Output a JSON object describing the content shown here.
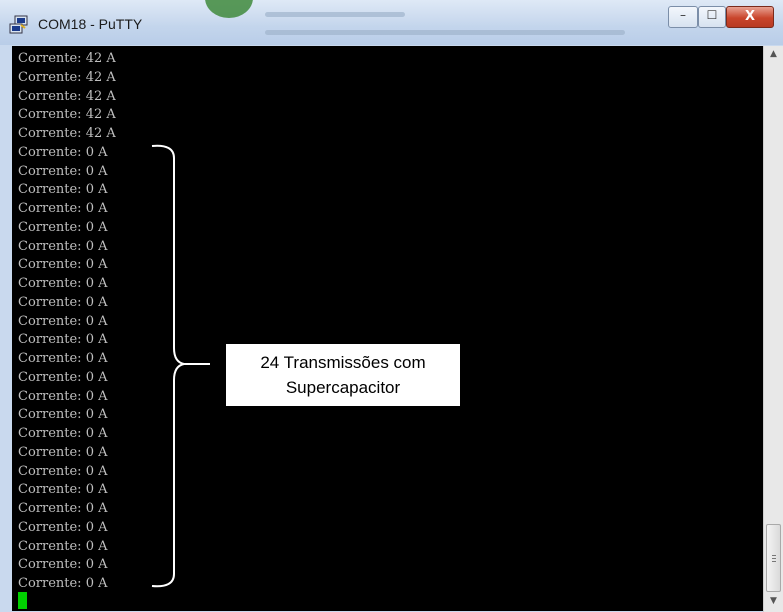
{
  "window": {
    "title": "COM18 - PuTTY"
  },
  "controls": {
    "minimize": "–",
    "maximize": "☐",
    "close": "X"
  },
  "terminal": {
    "lines": [
      "Corrente: 42 A",
      "Corrente: 42 A",
      "Corrente: 42 A",
      "Corrente: 42 A",
      "Corrente: 42 A",
      "Corrente: 0 A",
      "Corrente: 0 A",
      "Corrente: 0 A",
      "Corrente: 0 A",
      "Corrente: 0 A",
      "Corrente: 0 A",
      "Corrente: 0 A",
      "Corrente: 0 A",
      "Corrente: 0 A",
      "Corrente: 0 A",
      "Corrente: 0 A",
      "Corrente: 0 A",
      "Corrente: 0 A",
      "Corrente: 0 A",
      "Corrente: 0 A",
      "Corrente: 0 A",
      "Corrente: 0 A",
      "Corrente: 0 A",
      "Corrente: 0 A",
      "Corrente: 0 A",
      "Corrente: 0 A",
      "Corrente: 0 A",
      "Corrente: 0 A",
      "Corrente: 0 A"
    ],
    "cursor_color": "#00d000"
  },
  "annotation": {
    "line1": "24 Transmissões com",
    "line2": "Supercapacitor"
  },
  "scrollbar": {
    "up_icon": "▲",
    "down_icon": "▼"
  },
  "colors": {
    "terminal_bg": "#000000",
    "terminal_fg": "#bfbfbf",
    "bracket": "#ffffff"
  }
}
